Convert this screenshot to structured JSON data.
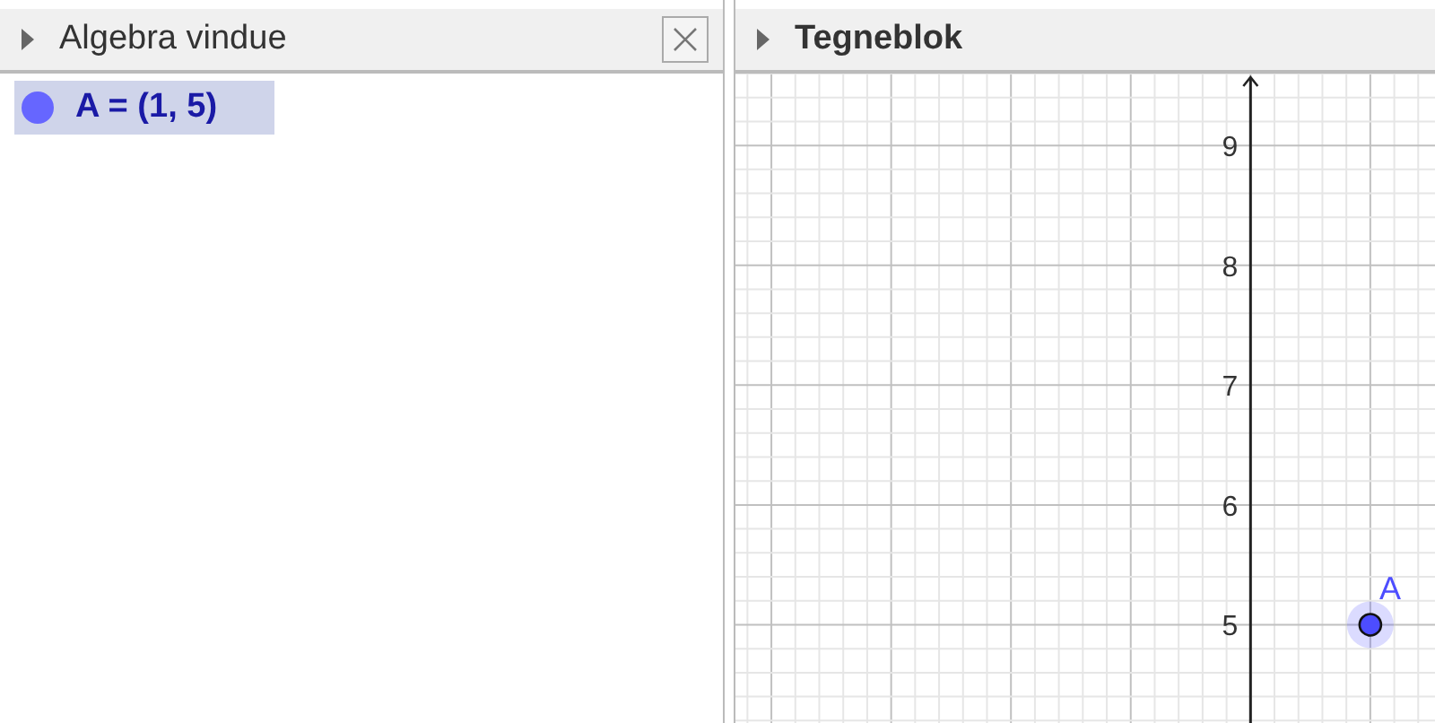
{
  "algebra_view": {
    "title": "Algebra vindue",
    "items": [
      {
        "text": "A = (1, 5)",
        "color": "#6666ff",
        "selected": true
      }
    ]
  },
  "graphics_view": {
    "title": "Tegneblok",
    "y_axis_labels": [
      "9",
      "8",
      "7",
      "6",
      "5"
    ],
    "points": [
      {
        "label": "A",
        "color": "#4d4dff"
      }
    ]
  }
}
